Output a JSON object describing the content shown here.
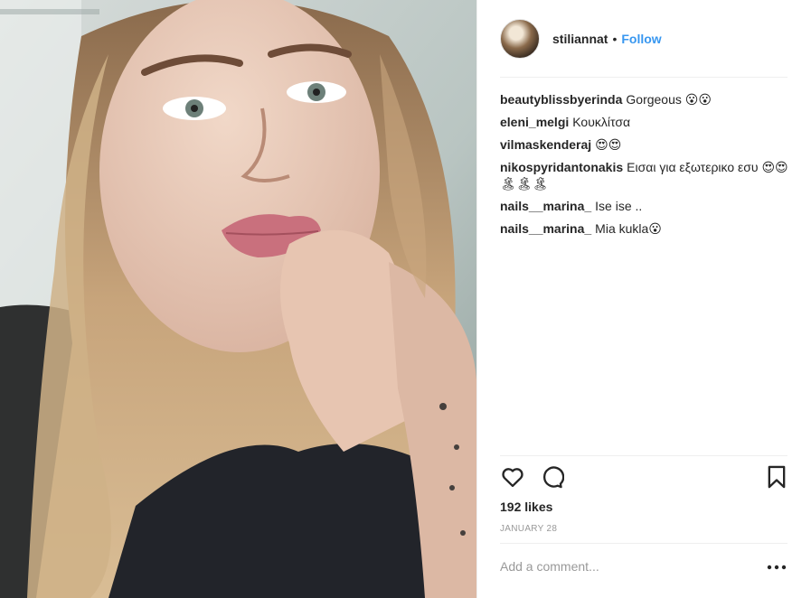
{
  "post": {
    "author": "stiliannat",
    "separator": "•",
    "follow_label": "Follow",
    "likes_text": "192 likes",
    "date": "January 28"
  },
  "comments": [
    {
      "user": "beautyblissbyerinda",
      "text": "Gorgeous 😮😮"
    },
    {
      "user": "eleni_melgi",
      "text": "Κουκλίτσα"
    },
    {
      "user": "vilmaskenderaj",
      "text": "😍😍"
    },
    {
      "user": "nikospyridantonakis",
      "text": "Εισαι για εξωτερικο εσυ 😍😍🏝🏝🏝"
    },
    {
      "user": "nails__marina_",
      "text": "Ise ise .."
    },
    {
      "user": "nails__marina_",
      "text": "Mia kukla😮"
    }
  ],
  "add_comment": {
    "placeholder": "Add a comment..."
  },
  "icons": {
    "like": "heart-icon",
    "comment": "comment-bubble-icon",
    "save": "bookmark-icon",
    "more": "more-dots-icon"
  },
  "colors": {
    "accent": "#3897f0",
    "text": "#262626",
    "muted": "#999999"
  }
}
